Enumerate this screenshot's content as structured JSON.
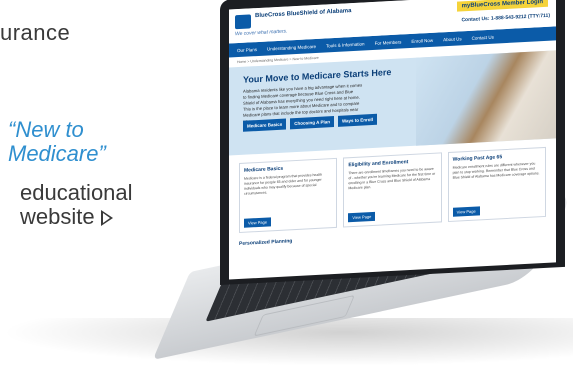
{
  "left_text": {
    "top_fragment": "urance",
    "quote_lines": [
      "“New to",
      "Medicare”"
    ],
    "desc_lines": [
      "educational",
      "website"
    ],
    "arrow_icon": "play-outline-icon"
  },
  "screen": {
    "brand": "BlueCross BlueShield of Alabama",
    "tagline": "We cover what matters.",
    "my_button": "myBlueCross Member Login",
    "contact": "Contact Us: 1-888-543-9212 (TTY:711)",
    "nav": [
      "Our Plans",
      "Understanding Medicare",
      "Tools & Information",
      "For Members",
      "Enroll Now",
      "About Us",
      "Contact Us"
    ],
    "breadcrumb": "Home > Understanding Medicare > New to Medicare",
    "hero_title": "Your Move to Medicare Starts Here",
    "hero_text": "Alabama residents like you have a big advantage when it comes to finding Medicare coverage because Blue Cross and Blue Shield of Alabama has everything you need right here at home. This is the place to learn more about Medicare and to compare Medicare plans that include the top doctors and hospitals near you.",
    "hero_buttons": [
      "Medicare Basics",
      "Choosing A Plan",
      "Ways to Enroll"
    ],
    "cards": [
      {
        "title": "Medicare Basics",
        "text": "Medicare is a federal program that provides health insurance for people 65 and older and for younger individuals who may qualify because of special circumstances.",
        "button": "View Page"
      },
      {
        "title": "Eligibility and Enrollment",
        "text": "There are enrollment timeframes you need to be aware of - whether you're learning Medicare for the first time or enrolling in a Blue Cross and Blue Shield of Alabama Medicare plan.",
        "button": "View Page"
      },
      {
        "title": "Working Past Age 65",
        "text": "Medicare enrollment rules are different whenever you plan to stop working. Remember that Blue Cross and Blue Shield of Alabama has Medicare coverage options.",
        "button": "View Page"
      }
    ],
    "plan_title": "Personalized Planning"
  }
}
